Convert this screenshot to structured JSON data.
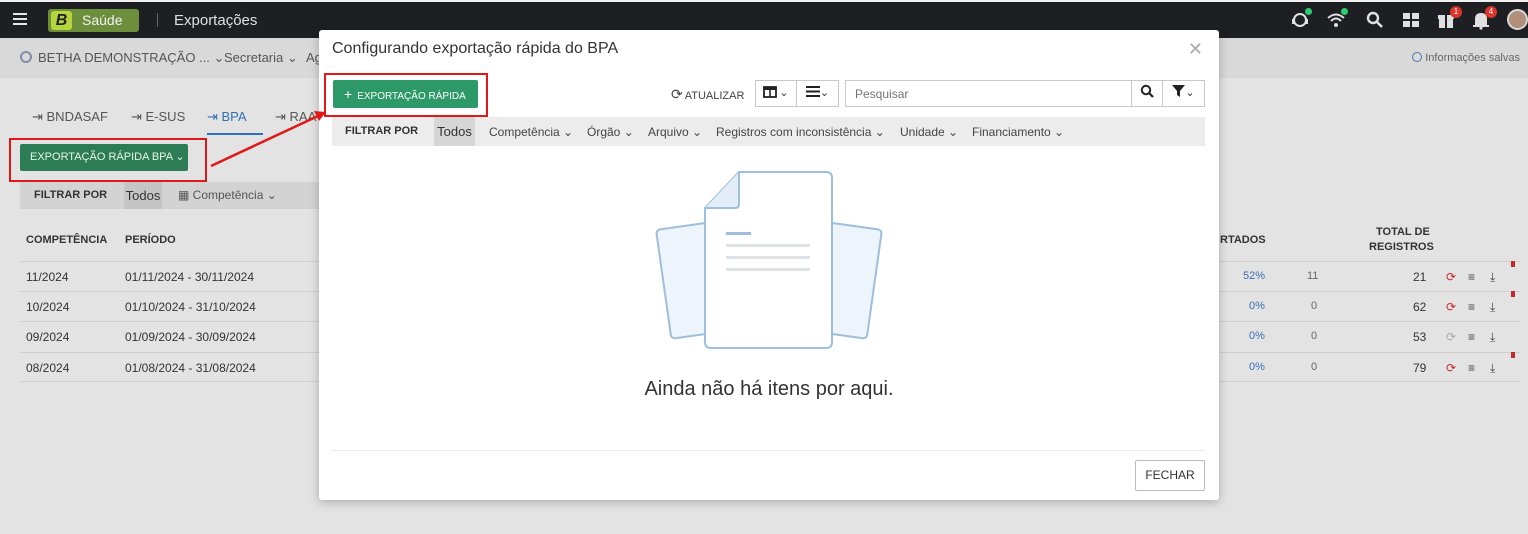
{
  "topbar": {
    "logo_letter": "B",
    "product": "Saúde",
    "module": "Exportações",
    "notif_badge_1": "1",
    "notif_badge_2": "4"
  },
  "context": {
    "entity": "BETHA DEMONSTRAÇÃO ...",
    "secretaria": "Secretaria",
    "ag": "Ag",
    "saved": "Informações salvas"
  },
  "background": {
    "tabs": [
      "BNDASAF",
      "E-SUS",
      "BPA",
      "RAA"
    ],
    "export_button": "EXPORTAÇÃO RÁPIDA BPA",
    "filter_label": "FILTRAR POR",
    "filter_all": "Todos",
    "filter_competencia": "Competência",
    "columns": {
      "competencia": "COMPETÊNCIA",
      "periodo": "PERÍODO",
      "exportados": "RTADOS",
      "total_line1": "TOTAL DE",
      "total_line2": "REGISTROS"
    },
    "rows": [
      {
        "competencia": "11/2024",
        "periodo": "01/11/2024 - 30/11/2024",
        "pct": "52%",
        "count": "11",
        "total": "21"
      },
      {
        "competencia": "10/2024",
        "periodo": "01/10/2024 - 31/10/2024",
        "pct": "0%",
        "count": "0",
        "total": "62"
      },
      {
        "competencia": "09/2024",
        "periodo": "01/09/2024 - 30/09/2024",
        "pct": "0%",
        "count": "0",
        "total": "53"
      },
      {
        "competencia": "08/2024",
        "periodo": "01/08/2024 - 31/08/2024",
        "pct": "0%",
        "count": "0",
        "total": "79"
      }
    ]
  },
  "modal": {
    "title": "Configurando exportação rápida do BPA",
    "quick_export_label": "EXPORTAÇÃO RÁPIDA",
    "refresh_label": "ATUALIZAR",
    "search_placeholder": "Pesquisar",
    "filter_label": "FILTRAR POR",
    "filter_all": "Todos",
    "filters": [
      "Competência",
      "Órgão",
      "Arquivo",
      "Registros com inconsistência",
      "Unidade",
      "Financiamento"
    ],
    "empty_message": "Ainda não há itens por aqui.",
    "close_label": "FECHAR"
  },
  "colors": {
    "accent_green": "#2e9968",
    "highlight_red": "#e01818",
    "link_blue": "#2f6fb5"
  }
}
